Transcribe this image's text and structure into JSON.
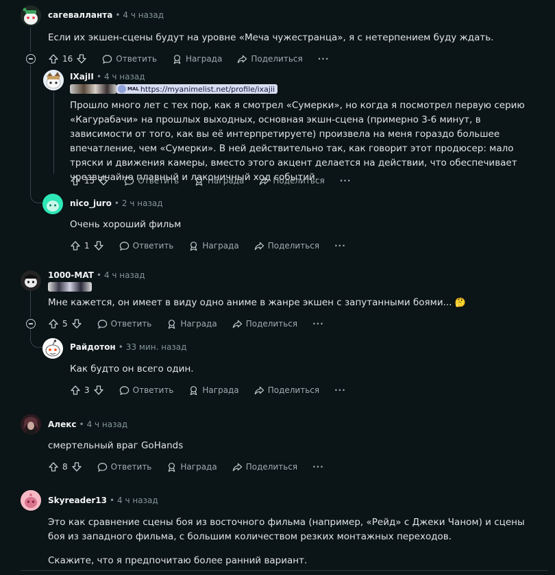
{
  "comments": [
    {
      "author": "сагевалланта",
      "time": "4 ч назад",
      "text": "Если их экшен-сцены будут на уровне «Меча чужестранца», я с нетерпением буду ждать.",
      "votes": "16",
      "reply": "Ответить",
      "award": "Награда",
      "share": "Поделиться"
    },
    {
      "author": "IXajII",
      "time": "4 ч назад",
      "flair_badge": "MAL",
      "flair_link": "https://myanimelist.net/profile/ixajii",
      "text": "Прошло много лет с тех пор, как я смотрел «Сумерки», но когда я посмотрел первую серию «Кагурабачи» на прошлых выходных, основная экшн-сцена (примерно 3-6 минут, в зависимости от того, как вы её интерпретируете) произвела на меня гораздо большее впечатление, чем «Сумерки». В ней действительно так, как говорит этот продюсер: мало тряски и движения камеры, вместо этого акцент делается на действии, что обеспечивает чрезвычайно плавный и лаконичный ход событий.",
      "votes": "15",
      "reply": "Ответить",
      "award": "Награда",
      "share": "Поделиться"
    },
    {
      "author": "nico_juro",
      "time": "2 ч назад",
      "text": "Очень хороший фильм",
      "votes": "1",
      "reply": "Ответить",
      "award": "Награда",
      "share": "Поделиться"
    },
    {
      "author": "1000-MAT",
      "time": "4 ч назад",
      "text": "Мне кажется, он имеет в виду одно аниме в жанре экшен с запутанными боями...",
      "emoji": "🤔",
      "votes": "5",
      "reply": "Ответить",
      "award": "Награда",
      "share": "Поделиться"
    },
    {
      "author": "Райдотон",
      "time": "33 мин. назад",
      "text": "Как будто он всего один.",
      "votes": "3",
      "reply": "Ответить",
      "award": "Награда",
      "share": "Поделиться"
    },
    {
      "author": "Алекс",
      "time": "4 ч назад",
      "text": "смертельный враг GoHands",
      "votes": "8",
      "reply": "Ответить",
      "award": "Награда",
      "share": "Поделиться"
    },
    {
      "author": "Skyreader13",
      "time": "4 ч назад",
      "text": "Это как сравнение сцены боя из восточного фильма (например, «Рейд» с Джеки Чаном) и сцены боя из западного фильма, с большим количеством резких монтажных переходов.",
      "text2": "Скажите, что я предпочитаю более ранний вариант."
    }
  ],
  "colors": {
    "background": "#0b1416",
    "thread_line": "#33464c",
    "meta": "#82959b",
    "text": "#e1e4e6"
  }
}
